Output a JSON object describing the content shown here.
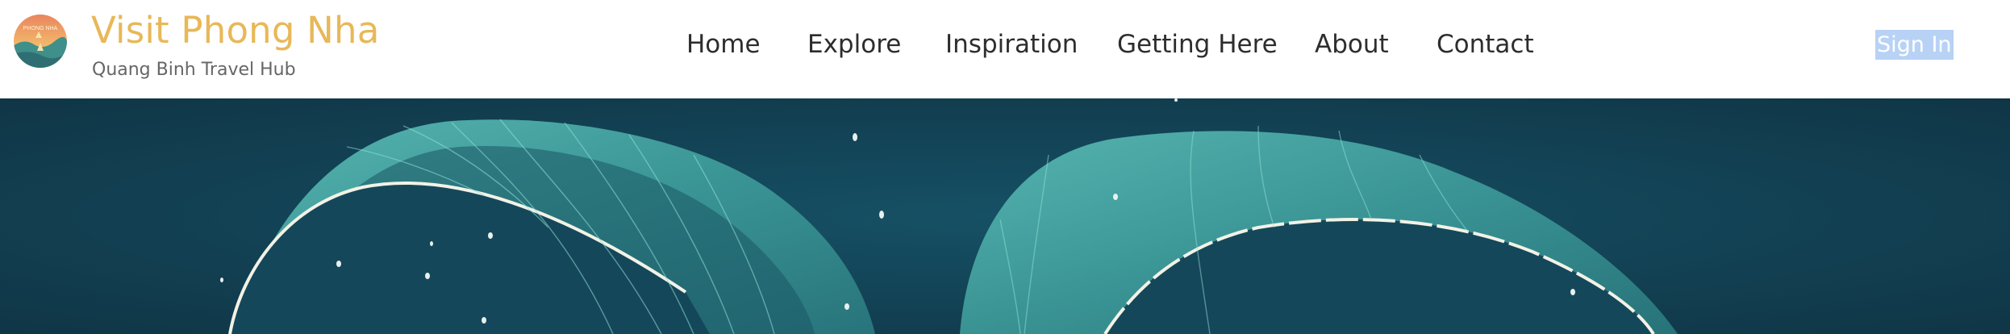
{
  "brand": {
    "title": "Visit Phong Nha",
    "subtitle": "Quang Binh Travel Hub",
    "logo_text": "PHONG NHA"
  },
  "nav": {
    "items": [
      "Home",
      "Explore",
      "Inspiration",
      "Getting Here",
      "About",
      "Contact"
    ]
  },
  "auth": {
    "sign_in_label": "Sign In"
  },
  "colors": {
    "brand_gold": "#e8b858",
    "nav_text": "#2d2d2d",
    "subtitle_text": "#666666",
    "sign_in_highlight": "#b8d2f5",
    "hero_water": "#123f50",
    "hero_net": "#4fb4ad"
  },
  "icons": {
    "logo": "sunset-landscape-logo-icon"
  }
}
